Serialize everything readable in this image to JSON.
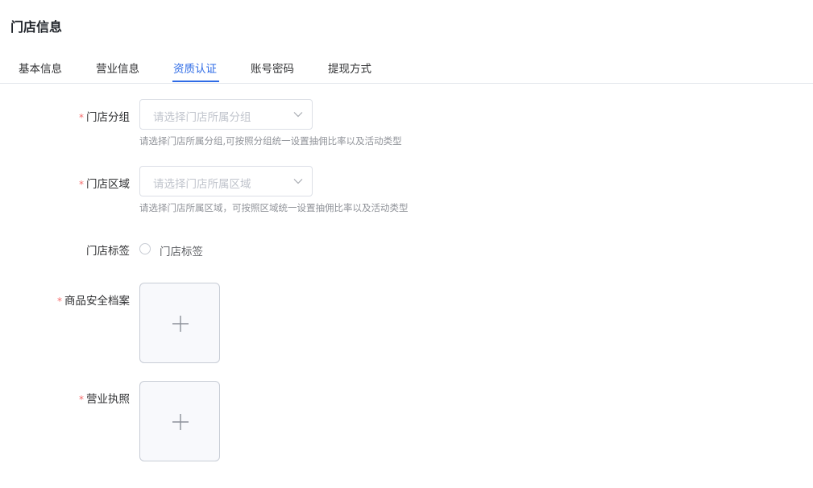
{
  "header": {
    "title": "门店信息"
  },
  "tabs": [
    {
      "label": "基本信息",
      "active": false
    },
    {
      "label": "营业信息",
      "active": false
    },
    {
      "label": "资质认证",
      "active": true
    },
    {
      "label": "账号密码",
      "active": false
    },
    {
      "label": "提现方式",
      "active": false
    }
  ],
  "form": {
    "store_group": {
      "label": "门店分组",
      "required": true,
      "placeholder": "请选择门店所属分组",
      "hint": "请选择门店所属分组,可按照分组统一设置抽佣比率以及活动类型"
    },
    "store_region": {
      "label": "门店区域",
      "required": true,
      "placeholder": "请选择门店所属区域",
      "hint": "请选择门店所属区域，可按照区域统一设置抽佣比率以及活动类型"
    },
    "store_tag": {
      "label": "门店标签",
      "required": false,
      "option_label": "门店标签",
      "checked": false
    },
    "product_safety_file": {
      "label": "商品安全档案",
      "required": true
    },
    "business_license": {
      "label": "营业执照",
      "required": true
    }
  },
  "colors": {
    "accent": "#2e6be6",
    "required_mark": "#f56c6c",
    "placeholder": "#c0c4cc",
    "hint": "#909399",
    "border": "#dcdfe6"
  },
  "icons": {
    "select_arrow": "chevron-down-icon",
    "upload": "plus-icon"
  }
}
